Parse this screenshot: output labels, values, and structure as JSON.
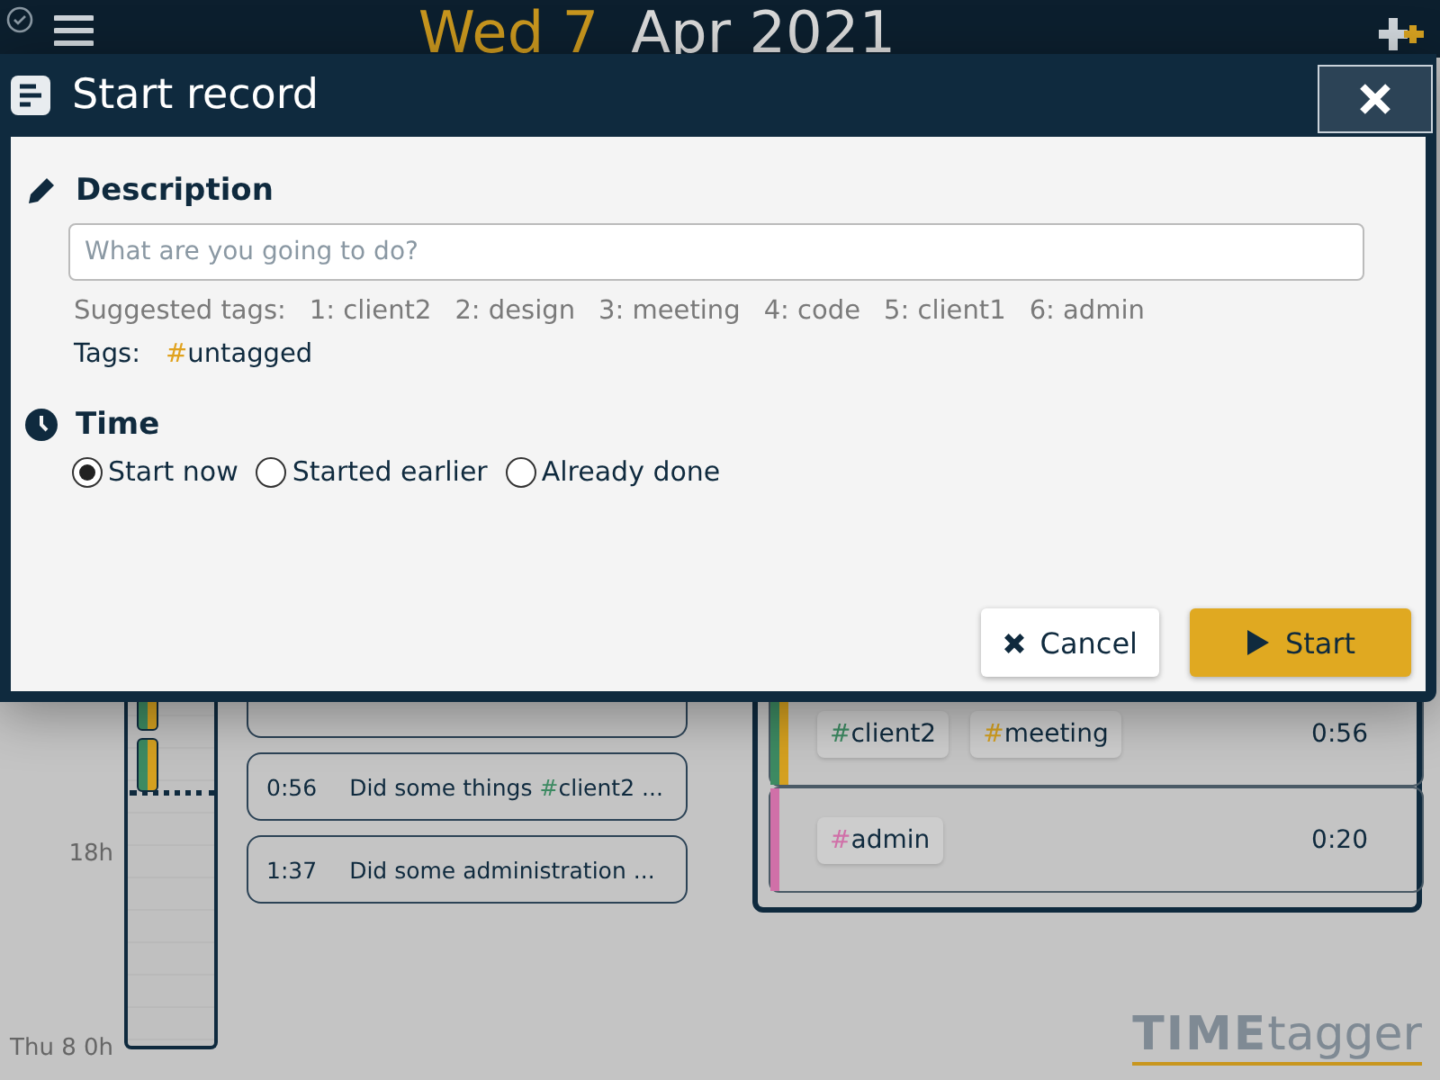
{
  "top_bar": {
    "day": "Wed 7",
    "month": "Apr 2021"
  },
  "dialog": {
    "title": "Start record",
    "description": {
      "heading": "Description",
      "placeholder": "What are you going to do?",
      "suggested_label": "Suggested tags:",
      "suggested_tags": [
        "1: client2",
        "2: design",
        "3: meeting",
        "4: code",
        "5: client1",
        "6: admin"
      ],
      "tags_label": "Tags:",
      "tags": [
        {
          "text": "#untagged",
          "color": "#e0a21e"
        }
      ]
    },
    "time": {
      "heading": "Time",
      "options": [
        {
          "label": "Start now",
          "selected": true
        },
        {
          "label": "Started earlier",
          "selected": false
        },
        {
          "label": "Already done",
          "selected": false
        }
      ]
    },
    "buttons": [
      {
        "kind": "cancel",
        "label": "Cancel"
      },
      {
        "kind": "start",
        "label": "Start"
      }
    ]
  },
  "timeline": {
    "labels": [
      "18h",
      "Thu 8 0h"
    ]
  },
  "records": [
    {
      "duration": "0:56",
      "text": "Did some things",
      "tag": {
        "text": "#client2",
        "color": "#3d8a62"
      },
      "ellipsis": "..."
    },
    {
      "duration": "1:37",
      "text": "Did some administration",
      "ellipsis": "..."
    }
  ],
  "overview": [
    {
      "tags": [
        {
          "text": "#client2",
          "color": "#3d8a62"
        },
        {
          "text": "#meeting",
          "color": "#d4a020"
        }
      ],
      "duration": "0:56"
    },
    {
      "tags": [
        {
          "text": "#admin",
          "color": "#d070a8"
        }
      ],
      "duration": "0:20"
    }
  ],
  "logo": {
    "bold": "TIME",
    "light": "tagger"
  }
}
